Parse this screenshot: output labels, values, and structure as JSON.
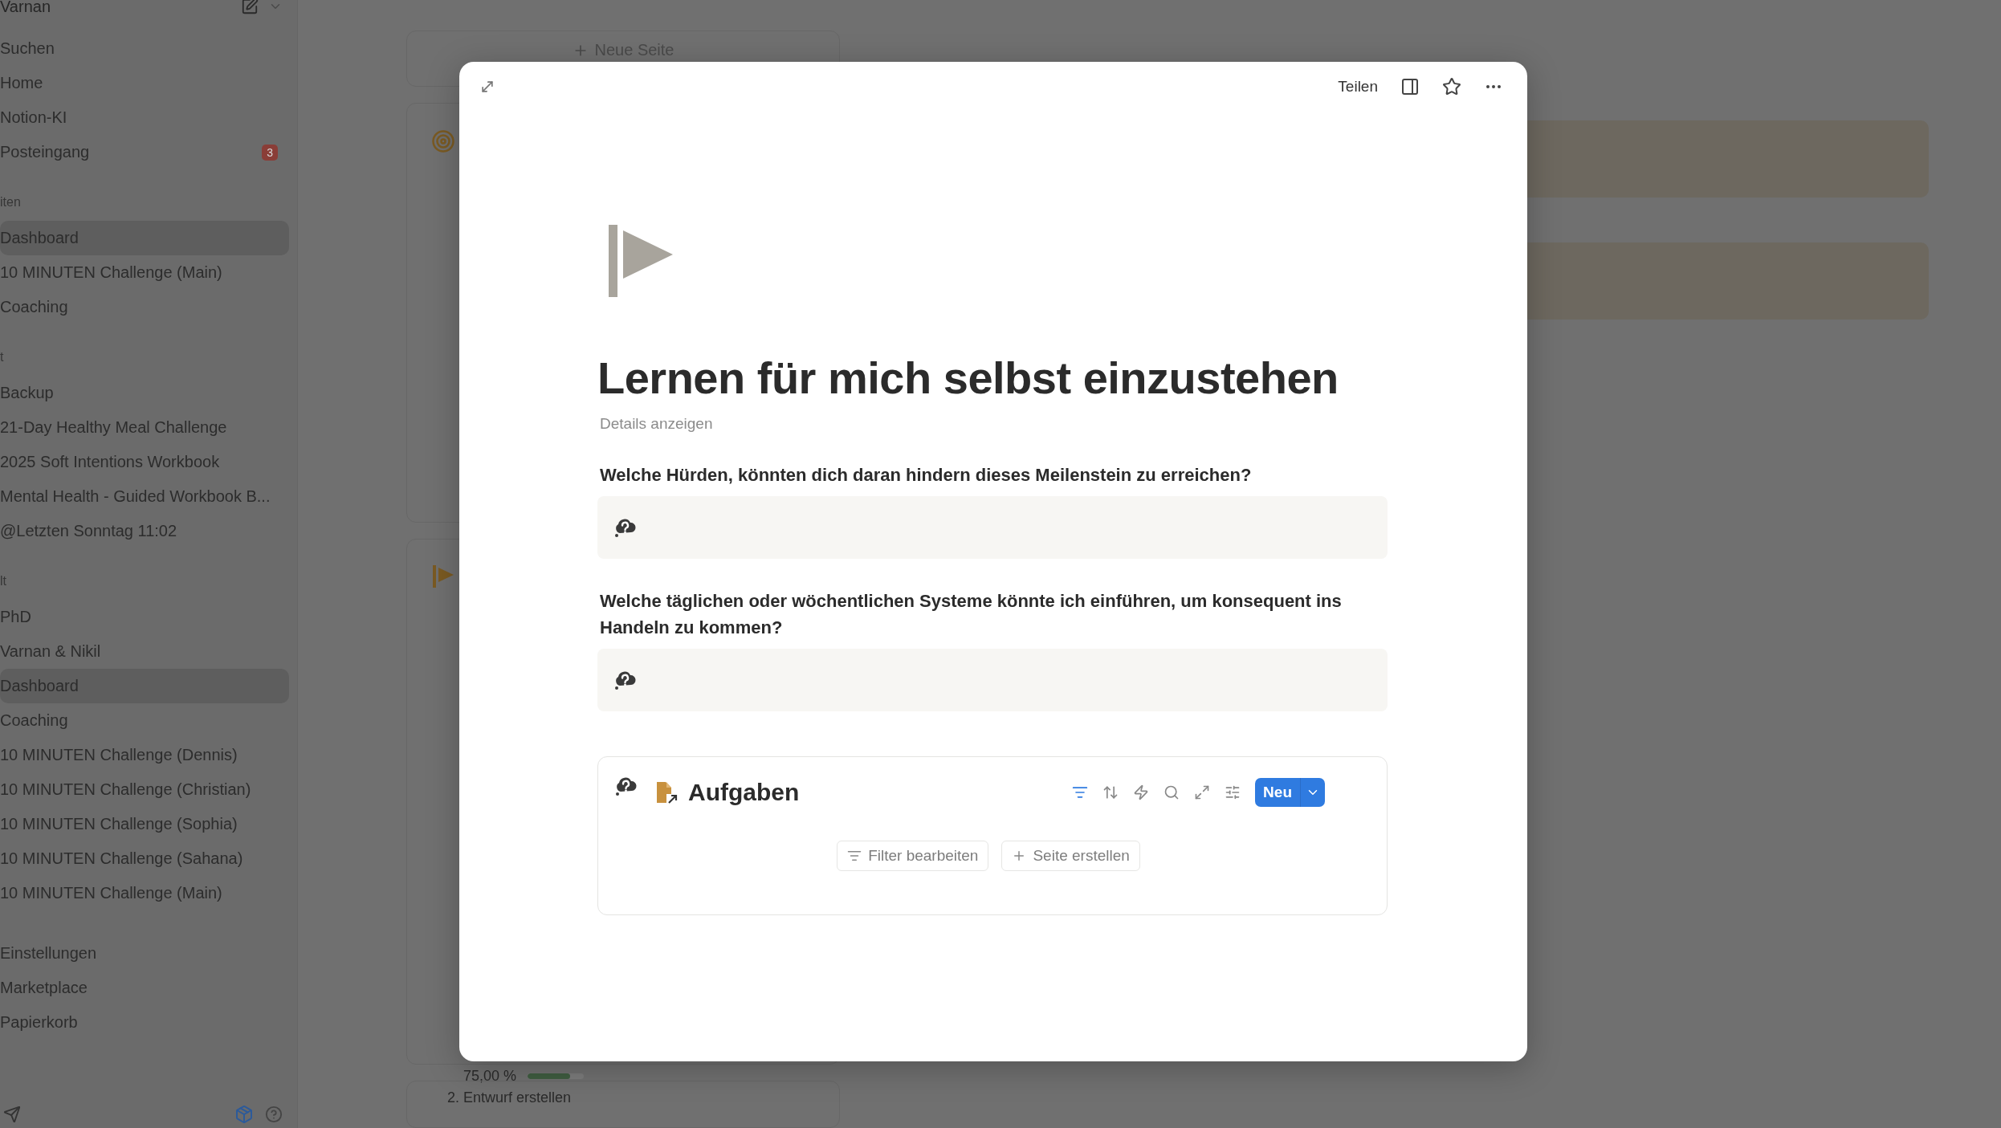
{
  "sidebar": {
    "workspace": "Varnan",
    "nav": [
      {
        "label": "Suchen"
      },
      {
        "label": "Home"
      },
      {
        "label": "Notion-KI"
      },
      {
        "label": "Posteingang",
        "badge": "3"
      }
    ],
    "sections": [
      {
        "heading": "iten",
        "items": [
          {
            "label": "Dashboard",
            "selected": true
          },
          {
            "label": "10 MINUTEN Challenge (Main)",
            "selected": false
          },
          {
            "label": "Coaching",
            "selected": false
          }
        ]
      },
      {
        "heading": "t",
        "items": [
          {
            "label": "Backup",
            "selected": false
          },
          {
            "label": "21-Day Healthy Meal Challenge",
            "selected": false
          },
          {
            "label": "2025 Soft Intentions Workbook",
            "selected": false
          },
          {
            "label": "Mental Health - Guided Workbook B...",
            "selected": false
          },
          {
            "label": "@Letzten Sonntag 11:02",
            "selected": false
          }
        ]
      },
      {
        "heading": "lt",
        "items": [
          {
            "label": "PhD",
            "selected": false
          },
          {
            "label": "Varnan & Nikil",
            "selected": false
          },
          {
            "label": "Dashboard",
            "selected": true
          },
          {
            "label": "Coaching",
            "selected": false
          },
          {
            "label": "10 MINUTEN Challenge (Dennis)",
            "selected": false
          },
          {
            "label": "10 MINUTEN Challenge (Christian)",
            "selected": false
          },
          {
            "label": "10 MINUTEN Challenge (Sophia)",
            "selected": false
          },
          {
            "label": "10 MINUTEN Challenge (Sahana)",
            "selected": false
          },
          {
            "label": "10 MINUTEN Challenge (Main)",
            "selected": false
          }
        ]
      },
      {
        "items": [
          {
            "label": "Einstellungen",
            "selected": false
          },
          {
            "label": "Marketplace",
            "selected": false
          },
          {
            "label": "Papierkorb",
            "selected": false
          }
        ]
      }
    ]
  },
  "background": {
    "new_page": "Neue Seite",
    "progress": {
      "reading": "75,00 %",
      "level": 0.75
    },
    "next_card": "2. Entwurf erstellen"
  },
  "modal": {
    "share": "Teilen",
    "title": "Lernen für mich selbst einzustehen",
    "details": "Details anzeigen",
    "questions": [
      {
        "text": "Welche Hürden, könnten dich daran hindern dieses Meilenstein zu erreichen?"
      },
      {
        "text": "Welche täglichen oder wöchentlichen Systeme könnte ich einführen, um konsequent ins Handeln zu kommen?"
      }
    ],
    "database": {
      "title": "Aufgaben",
      "new": "Neu",
      "buttons": [
        {
          "kind": "filter",
          "label": "Filter bearbeiten"
        },
        {
          "kind": "create",
          "label": "Seite erstellen"
        }
      ]
    }
  }
}
